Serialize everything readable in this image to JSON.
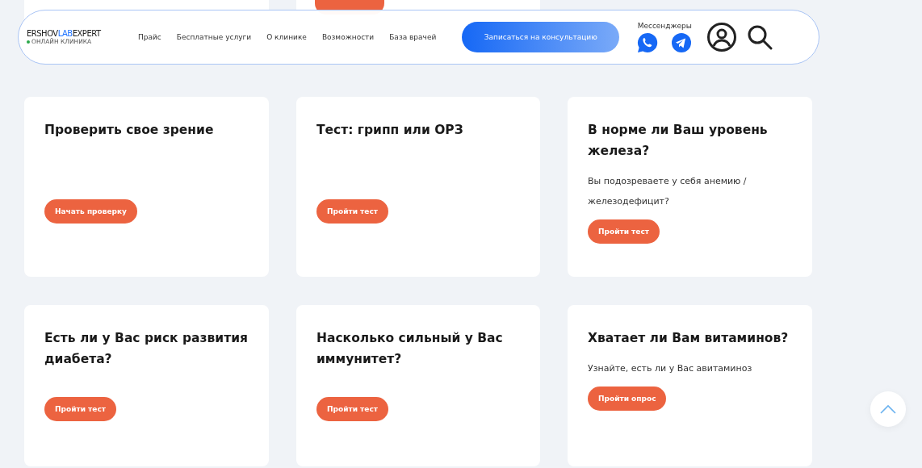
{
  "header": {
    "logo": {
      "name_start": "ERSHOV",
      "name_accent": "LAB",
      "name_end": "EXPERT",
      "tagline": "ОНЛАЙН КЛИНИКА"
    },
    "nav": [
      "Прайс",
      "Бесплатные услуги",
      "О клинике",
      "Возможности",
      "База врачей"
    ],
    "cta": "Записаться на консультацию",
    "messengers_label": "Мессенджеры"
  },
  "cards": [
    {
      "title": "Проверить свое зрение",
      "button": "Начать проверку"
    },
    {
      "title": "Тест: грипп или ОРЗ",
      "button": "Пройти тест"
    },
    {
      "title": "В норме ли Ваш уровень железа?",
      "text": "Вы подозреваете у себя анемию / железодефицит?",
      "button": "Пройти тест"
    },
    {
      "title": "Есть ли у Вас риск развития диабета?",
      "button": "Пройти тест"
    },
    {
      "title": "Насколько сильный у Вас иммунитет?",
      "button": "Пройти тест"
    },
    {
      "title": "Хватает ли Вам витаминов?",
      "text": "Узнайте, есть ли у Вас авитаминоз",
      "button": "Пройти опрос"
    }
  ]
}
